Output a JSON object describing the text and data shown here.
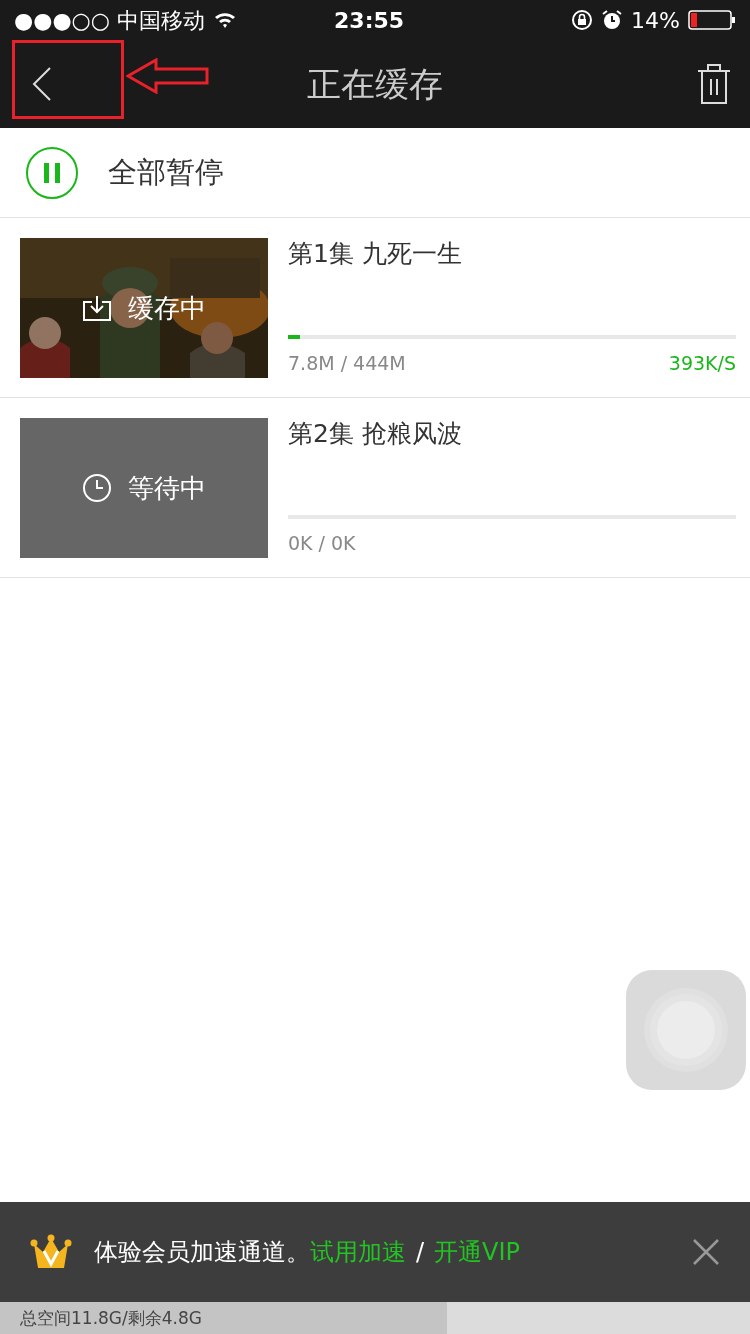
{
  "status_bar": {
    "carrier": "●●●○○ 中国移动",
    "time": "23:55",
    "battery": "14%"
  },
  "nav": {
    "title": "正在缓存"
  },
  "pause_all": {
    "label": "全部暂停"
  },
  "episodes": [
    {
      "title": "第1集 九死一生",
      "kind": "downloading",
      "status": "缓存中",
      "level": 0.027,
      "size": "7.8M / 444M",
      "speed": "393K/S"
    },
    {
      "title": "第2集 抢粮风波",
      "kind": "waiting",
      "status": "等待中",
      "level": 0,
      "size": "0K / 0K"
    }
  ],
  "promo": {
    "text": "体验会员加速通道。",
    "trial_link": "试用加速",
    "separator": "/",
    "vip_link": "开通VIP"
  },
  "storage": {
    "text": "总空间11.8G/剩余4.8G",
    "level": 0.596
  }
}
